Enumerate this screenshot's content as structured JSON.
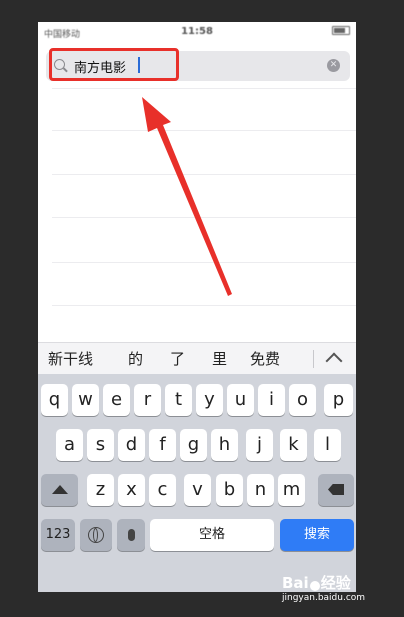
{
  "status_bar": {
    "carrier": "中国移动",
    "time": "11:58"
  },
  "search": {
    "value": "南方电影",
    "clear_glyph": "✕"
  },
  "candidates": [
    "新干线",
    "的",
    "了",
    "里",
    "免费"
  ],
  "keyboard": {
    "row1": [
      "q",
      "w",
      "e",
      "r",
      "t",
      "y",
      "u",
      "i",
      "o",
      "p"
    ],
    "row2": [
      "a",
      "s",
      "d",
      "f",
      "g",
      "h",
      "j",
      "k",
      "l"
    ],
    "row3": [
      "z",
      "x",
      "c",
      "v",
      "b",
      "n",
      "m"
    ],
    "numbers_label": "123",
    "space_label": "空格",
    "return_label": "搜索"
  },
  "watermark": {
    "brand": "Bai",
    "brand_suffix": "经验",
    "url": "jingyan.baidu.com"
  },
  "colors": {
    "annotation": "#e8302a",
    "return_key": "#2f7cf6"
  }
}
